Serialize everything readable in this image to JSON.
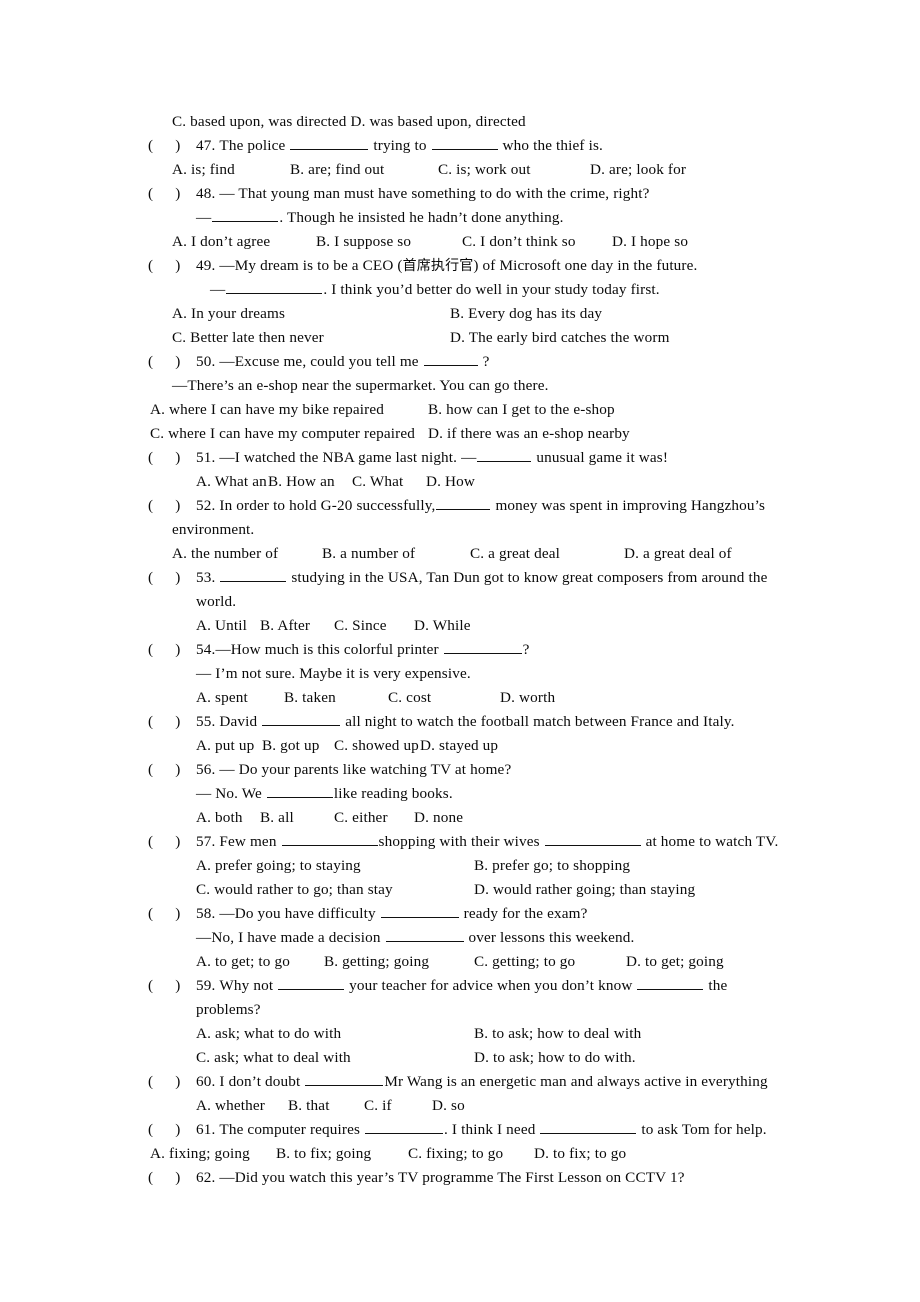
{
  "document": {
    "type": "multiple-choice grammar worksheet",
    "language": "English with Chinese gloss"
  },
  "leading_line": "C. based upon, was directed   D. was based upon, directed",
  "marker": {
    "open": "(",
    "close": ")"
  },
  "items": [
    {
      "number": "47.",
      "stem_before": "The police",
      "stem_mid": "trying to",
      "stem_after": "who the thief is.",
      "options": [
        "A. is; find",
        "B. are; find out",
        "C. is; work out",
        "D. are; look for"
      ]
    },
    {
      "number": "48.",
      "stem": "— That young man must have something to do with the crime, right?",
      "reply_lead": "—",
      "reply_after": ". Though he insisted he hadn’t done anything.",
      "options": [
        "A. I don’t agree",
        "B. I suppose so",
        "C. I don’t think so",
        "D. I hope so"
      ]
    },
    {
      "number": "49.",
      "stem_a": "—My dream is to be a CEO (",
      "stem_cjk": "首席执行官",
      "stem_b": ") of Microsoft one day in the future.",
      "reply_lead": "—",
      "reply_after": ". I think you’d better do well in your study today first.",
      "options_row1": [
        "A. In your dreams",
        "B. Every dog has its day"
      ],
      "options_row2": [
        "C. Better late then never",
        "D. The early bird catches the worm"
      ]
    },
    {
      "number": "50.",
      "stem_before": "—Excuse me, could you tell me",
      "stem_after": "?",
      "reply": "—There’s an e-shop near the supermarket. You can go there.",
      "options_row1": [
        "A. where I can have my bike repaired",
        "B. how can I get to the e-shop"
      ],
      "options_row2": [
        "C. where I can have my computer repaired",
        "D. if there was an e-shop nearby"
      ]
    },
    {
      "number": "51.",
      "stem_before": "—I watched the NBA game last night. —",
      "stem_after": "unusual game it was!",
      "options": [
        "A. What an",
        "B. How an",
        "C. What",
        "D. How"
      ]
    },
    {
      "number": "52.",
      "stem_before": "In order to hold G-20 successfully,",
      "stem_after": "money was spent in improving Hangzhou’s",
      "stem_cont": "environment.",
      "options": [
        "A. the number of",
        "B. a number of",
        "C. a great deal",
        "D. a great deal of"
      ]
    },
    {
      "number": "53.",
      "stem_before": "",
      "stem_after": "studying in the USA, Tan Dun got to know great composers from around the",
      "stem_cont": "world.",
      "options": [
        "A. Until",
        "B. After",
        "C. Since",
        "D. While"
      ]
    },
    {
      "number": "54.",
      "stem_before": "—How much is this colorful printer",
      "stem_after": "?",
      "reply": "— I’m not sure. Maybe it is very expensive.",
      "options": [
        "A. spent",
        "B. taken",
        "C. cost",
        "D. worth"
      ]
    },
    {
      "number": "55.",
      "stem_before": "David",
      "stem_after": "all night to watch the football match between France and Italy.",
      "options": [
        "A. put up",
        "B. got up",
        "C. showed up",
        "D. stayed up"
      ]
    },
    {
      "number": "56.",
      "stem": "— Do your parents like watching TV at home?",
      "reply_before": "— No. We",
      "reply_after": "like reading books.",
      "options": [
        "A. both",
        "B. all",
        "C. either",
        "D. none"
      ]
    },
    {
      "number": "57.",
      "stem_before": "Few men",
      "stem_mid": "shopping with their wives",
      "stem_after": "at home to watch TV.",
      "options_row1": [
        "A. prefer going; to staying",
        "B. prefer go; to shopping"
      ],
      "options_row2": [
        "C. would rather to go; than stay",
        "D. would rather going; than staying"
      ]
    },
    {
      "number": "58.",
      "stem_before": "—Do you have difficulty",
      "stem_after": "ready for the exam?",
      "reply_before": "—No, I have made a decision",
      "reply_after": "over lessons this weekend.",
      "options": [
        "A. to get; to go",
        "B. getting; going",
        "C. getting; to go",
        "D. to get; going"
      ]
    },
    {
      "number": "59.",
      "stem_before": "Why not",
      "stem_mid": "your teacher for advice when you don’t know",
      "stem_after": "the",
      "stem_cont": "problems?",
      "options_row1": [
        "A. ask; what to do with",
        "B. to ask; how to deal with"
      ],
      "options_row2": [
        "C. ask; what to deal with",
        "D. to ask; how to do with."
      ]
    },
    {
      "number": "60.",
      "stem_before": "I don’t doubt",
      "stem_after": "Mr Wang is an energetic man and always active in everything",
      "options": [
        "A. whether",
        "B. that",
        "C. if",
        "D. so"
      ]
    },
    {
      "number": "61.",
      "stem_before": "The computer requires",
      "stem_mid": ". I think I need",
      "stem_after": "to ask Tom for help.",
      "options": [
        "A. fixing; going",
        "B. to fix; going",
        "C. fixing; to go",
        "D. to fix; to go"
      ]
    },
    {
      "number": "62.",
      "stem": "—Did you watch this year’s TV programme The First Lesson on CCTV 1?"
    }
  ]
}
